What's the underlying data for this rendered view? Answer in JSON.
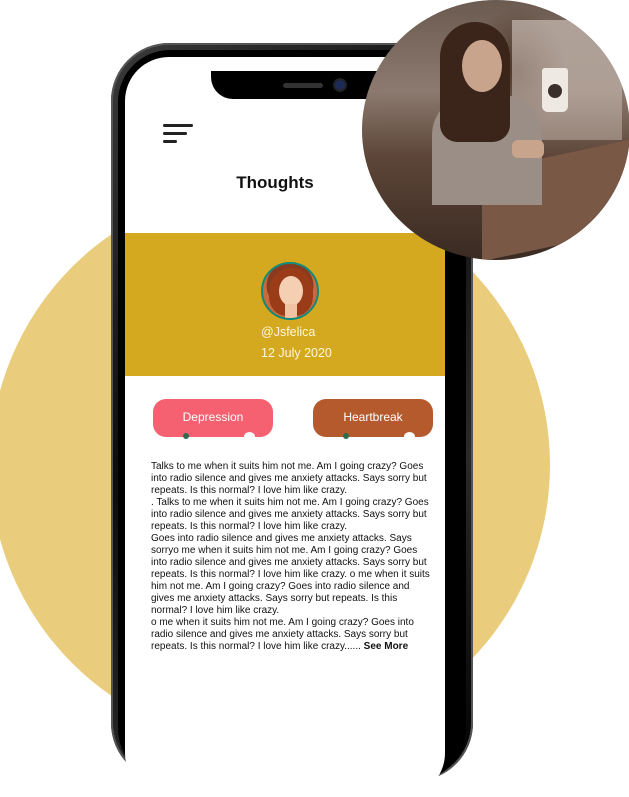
{
  "header": {
    "title": "Thoughts"
  },
  "profile": {
    "handle": "@Jsfelica",
    "date": "12 July 2020"
  },
  "tags": [
    {
      "label": "Depression",
      "color": "#f56170"
    },
    {
      "label": "Heartbreak",
      "color": "#b55a2d"
    }
  ],
  "post": {
    "paragraphs": [
      "Talks to me when it suits him not me. Am I going crazy? Goes into radio silence and gives me anxiety attacks. Says sorry but repeats. Is this normal? I love him like crazy.",
      ". Talks to me when it suits him not me. Am I going crazy? Goes into radio silence and gives me anxiety attacks. Says sorry but repeats. Is this normal? I love him like crazy.",
      "Goes into radio silence and gives me anxiety attacks. Says sorryo me when it suits him not me. Am I going crazy? Goes into radio silence and gives me anxiety attacks. Says sorry but repeats. Is this normal? I love him like crazy. o me when it suits him not me. Am I going crazy? Goes into radio silence and gives me anxiety attacks. Says sorry but repeats. Is this normal? I love him like crazy.",
      "o me when it suits him not me. Am I going crazy? Goes into radio silence and gives me anxiety attacks. Says sorry but repeats. Is this normal? I love him like crazy......"
    ],
    "see_more": "See More"
  },
  "icons": {
    "menu": "hamburger-menu-icon",
    "avatar": "user-avatar",
    "photo": "woman-with-phone-photo"
  },
  "colors": {
    "background_circle": "#e9cd7d",
    "profile_band": "#d4a81f",
    "avatar_ring": "#0f8a7b"
  }
}
